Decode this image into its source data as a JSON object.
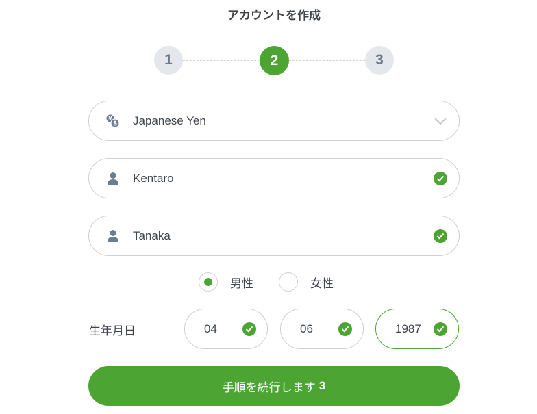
{
  "page": {
    "title": "アカウントを作成"
  },
  "stepper": {
    "steps": [
      {
        "label": "1",
        "active": false
      },
      {
        "label": "2",
        "active": true
      },
      {
        "label": "3",
        "active": false
      }
    ]
  },
  "currency": {
    "value": "Japanese Yen",
    "icon": "currency-exchange-icon"
  },
  "first_name": {
    "value": "Kentaro",
    "icon": "user-icon",
    "valid": true
  },
  "last_name": {
    "value": "Tanaka",
    "icon": "user-icon",
    "valid": true
  },
  "gender": {
    "options": [
      {
        "label": "男性",
        "selected": true
      },
      {
        "label": "女性",
        "selected": false
      }
    ]
  },
  "dob": {
    "label": "生年月日",
    "month": "04",
    "day": "06",
    "year": "1987"
  },
  "submit": {
    "label": "手順を続行します",
    "step": "3"
  },
  "colors": {
    "accent": "#4ca533",
    "border": "#cdd1d5",
    "muted": "#e4e7eb",
    "icon": "#6b7d92"
  }
}
